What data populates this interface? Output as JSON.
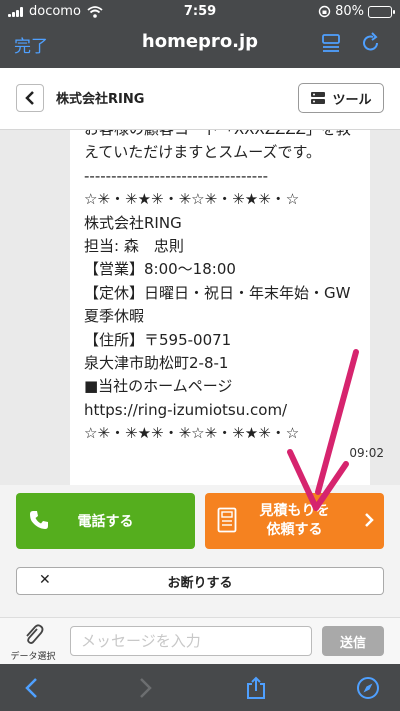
{
  "status_bar": {
    "carrier": "docomo",
    "time": "7:59",
    "battery_percent": "80%",
    "battery_level": 0.8
  },
  "browser": {
    "done_label": "完了",
    "host": "homepro.jp"
  },
  "header": {
    "title": "株式会社RING",
    "tool_label": "ツール"
  },
  "message": {
    "lines": [
      "お客様の顧客コード「XXXZZZZ」を教",
      "えていただけますとスムーズです。",
      "----------------------------------",
      "☆✳・✳★✳・✳☆✳・✳★✳・☆",
      "株式会社RING",
      "担当: 森　忠則",
      "【営業】8:00〜18:00",
      "【定休】日曜日・祝日・年末年始・GW・",
      "夏季休暇",
      "【住所】〒595-0071",
      "泉大津市助松町2-8-1",
      "■当社のホームページ",
      "https://ring-izumiotsu.com/",
      "☆✳・✳★✳・✳☆✳・✳★✳・☆"
    ],
    "time": "09:02"
  },
  "actions": {
    "call_label": "電話する",
    "quote_line1": "見積もりを",
    "quote_line2": "依頼する",
    "decline_label": "お断りする"
  },
  "input": {
    "attach_label": "データ選択",
    "placeholder": "メッセージを入力",
    "send_label": "送信"
  },
  "colors": {
    "chrome": "#47494b",
    "link_blue": "#4fa0ff",
    "call_green": "#55ae1e",
    "quote_orange": "#f58220",
    "arrow_magenta": "#d6246e"
  }
}
